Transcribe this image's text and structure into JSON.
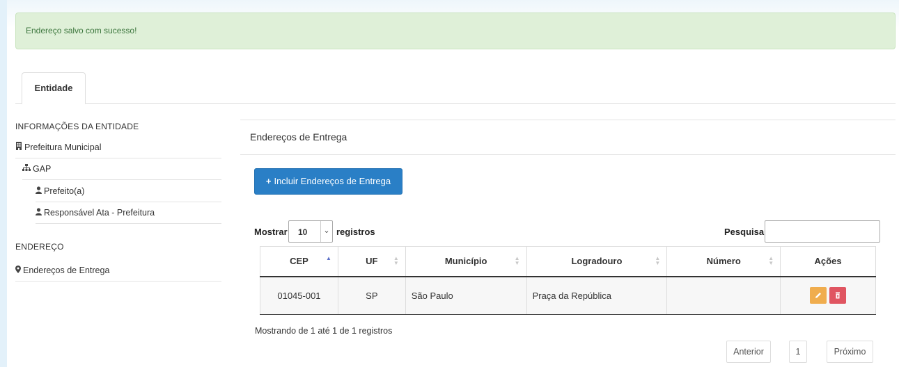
{
  "alert": {
    "message": "Endereço salvo com sucesso!",
    "color": "#dff0d8"
  },
  "tabs": [
    {
      "label": "Entidade",
      "active": true
    }
  ],
  "sidebar": {
    "section1_title": "INFORMAÇÕES DA ENTIDADE",
    "items": [
      {
        "label": "Prefeitura Municipal",
        "icon": "building-icon"
      },
      {
        "label": "GAP",
        "icon": "sitemap-icon"
      },
      {
        "label": "Prefeito(a)",
        "icon": "user-icon"
      },
      {
        "label": "Responsável Ata - Prefeitura",
        "icon": "user-icon"
      }
    ],
    "section2_title": "ENDEREÇO",
    "address_item": {
      "label": "Endereços de Entrega",
      "icon": "map-marker-icon"
    }
  },
  "main": {
    "panel_title": "Endereços de Entrega",
    "add_button": "Incluir Endereços de Entrega",
    "length_prefix": "Mostrar",
    "length_value": "10",
    "length_suffix": "registros",
    "search_label": "Pesquisar",
    "search_value": "",
    "table": {
      "columns": [
        "CEP",
        "UF",
        "Município",
        "Logradouro",
        "Número",
        "Ações"
      ],
      "rows": [
        {
          "cep": "01045-001",
          "uf": "SP",
          "municipio": "São Paulo",
          "logradouro": "Praça da República",
          "numero": ""
        }
      ]
    },
    "info": "Mostrando de 1 até 1 de 1 registros",
    "pagination": {
      "prev": "Anterior",
      "page": "1",
      "next": "Próximo"
    }
  },
  "colors": {
    "primary": "#2a7fc6",
    "edit": "#f0ad4e",
    "delete": "#e05561"
  }
}
